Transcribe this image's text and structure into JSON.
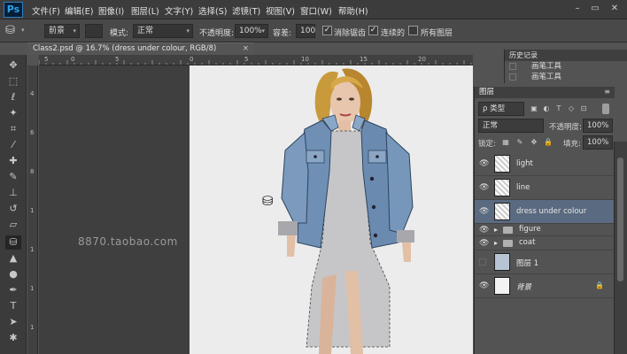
{
  "app": {
    "logo": "Ps"
  },
  "menu": [
    "文件(F)",
    "编辑(E)",
    "图像(I)",
    "图层(L)",
    "文字(Y)",
    "选择(S)",
    "滤镜(T)",
    "视图(V)",
    "窗口(W)",
    "帮助(H)"
  ],
  "window_controls": {
    "minimize": "–",
    "restore": "▭",
    "close": "✕"
  },
  "options": {
    "fill_source": "前景",
    "mode_label": "模式:",
    "mode_value": "正常",
    "opacity_label": "不透明度:",
    "opacity_value": "100%",
    "tolerance_label": "容差:",
    "tolerance_value": "100",
    "antialias_label": "消除锯齿",
    "contiguous_label": "连续的",
    "all_layers_label": "所有图层"
  },
  "document": {
    "tab_title": "Class2.psd @ 16.7% (dress under colour, RGB/8)",
    "close": "×"
  },
  "rulers": {
    "h": [
      "5",
      "0",
      "5",
      "0",
      "5",
      "10",
      "15",
      "20"
    ],
    "v": [
      "4",
      "6",
      "8",
      "1",
      "1",
      "1",
      "1",
      "1"
    ]
  },
  "watermark": "8870.taobao.com",
  "history": {
    "title": "历史记录",
    "items": [
      "画笔工具",
      "画笔工具"
    ]
  },
  "layers": {
    "title": "图层",
    "filter_label": "ρ 类型",
    "blend_mode": "正常",
    "opacity_label": "不透明度:",
    "opacity_value": "100%",
    "lock_label": "锁定:",
    "fill_label": "填充:",
    "fill_value": "100%",
    "items": [
      {
        "name": "light"
      },
      {
        "name": "line"
      },
      {
        "name": "dress under colour"
      },
      {
        "name": "figure"
      },
      {
        "name": "coat"
      },
      {
        "name": "图层 1"
      },
      {
        "name": "背景"
      }
    ]
  }
}
